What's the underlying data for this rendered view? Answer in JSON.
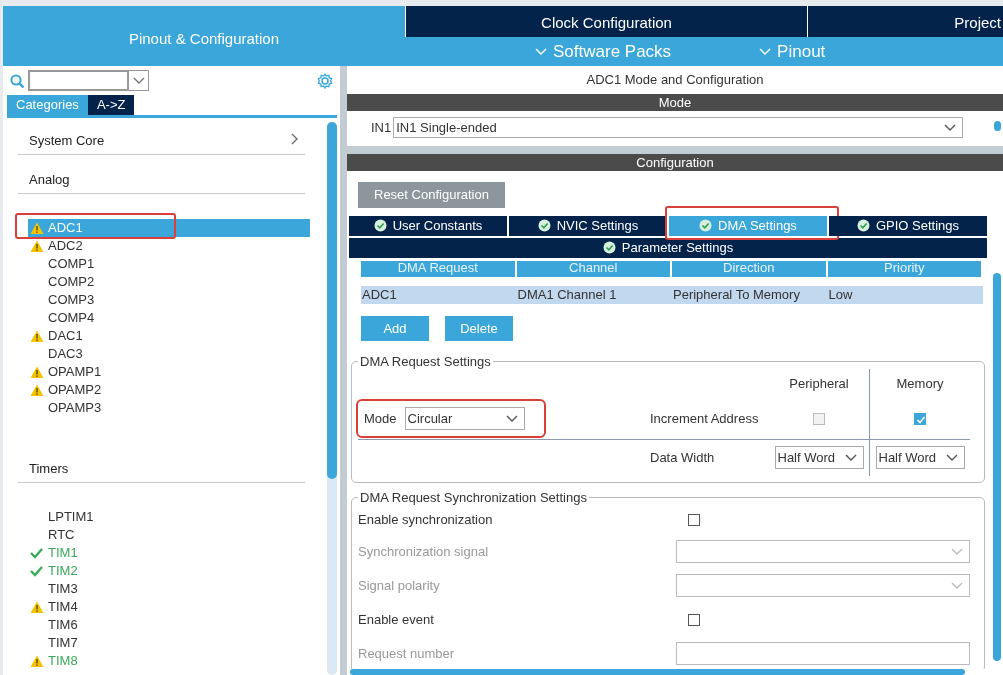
{
  "top_tabs": [
    {
      "label": "Pinout & Configuration",
      "selected": true
    },
    {
      "label": "Clock Configuration",
      "selected": false
    },
    {
      "label": "Project",
      "selected": false
    }
  ],
  "menus": [
    "Software Packs",
    "Pinout"
  ],
  "sidebar": {
    "view_tabs": [
      {
        "label": "Categories",
        "selected": true
      },
      {
        "label": "A->Z",
        "selected": false
      }
    ],
    "categories": [
      {
        "label": "System Core",
        "expanded": false
      },
      {
        "label": "Analog",
        "expanded": true,
        "children": [
          {
            "label": "ADC1",
            "kind": "warning",
            "configured": false,
            "selected": true,
            "highlighted": true
          },
          {
            "label": "ADC2",
            "kind": "warning",
            "configured": false,
            "selected": false,
            "highlighted": false
          },
          {
            "label": "COMP1",
            "kind": "plain",
            "configured": false,
            "selected": false,
            "highlighted": false
          },
          {
            "label": "COMP2",
            "kind": "plain",
            "configured": false,
            "selected": false,
            "highlighted": false
          },
          {
            "label": "COMP3",
            "kind": "plain",
            "configured": false,
            "selected": false,
            "highlighted": false
          },
          {
            "label": "COMP4",
            "kind": "plain",
            "configured": false,
            "selected": false,
            "highlighted": false
          },
          {
            "label": "DAC1",
            "kind": "warning",
            "configured": false,
            "selected": false,
            "highlighted": false
          },
          {
            "label": "DAC3",
            "kind": "plain",
            "configured": false,
            "selected": false,
            "highlighted": false
          },
          {
            "label": "OPAMP1",
            "kind": "warning",
            "configured": false,
            "selected": false,
            "highlighted": false
          },
          {
            "label": "OPAMP2",
            "kind": "warning",
            "configured": false,
            "selected": false,
            "highlighted": false
          },
          {
            "label": "OPAMP3",
            "kind": "plain",
            "configured": false,
            "selected": false,
            "highlighted": false
          }
        ]
      },
      {
        "label": "Timers",
        "expanded": true,
        "children": [
          {
            "label": "LPTIM1",
            "kind": "plain",
            "configured": false,
            "selected": false,
            "highlighted": false
          },
          {
            "label": "RTC",
            "kind": "plain",
            "configured": false,
            "selected": false,
            "highlighted": false
          },
          {
            "label": "TIM1",
            "kind": "ok",
            "configured": true,
            "selected": false,
            "highlighted": false
          },
          {
            "label": "TIM2",
            "kind": "ok",
            "configured": true,
            "selected": false,
            "highlighted": false
          },
          {
            "label": "TIM3",
            "kind": "plain",
            "configured": false,
            "selected": false,
            "highlighted": false
          },
          {
            "label": "TIM4",
            "kind": "warning",
            "configured": false,
            "selected": false,
            "highlighted": false
          },
          {
            "label": "TIM6",
            "kind": "plain",
            "configured": false,
            "selected": false,
            "highlighted": false
          },
          {
            "label": "TIM7",
            "kind": "plain",
            "configured": false,
            "selected": false,
            "highlighted": false
          },
          {
            "label": "TIM8",
            "kind": "warning",
            "configured": true,
            "selected": false,
            "highlighted": false
          }
        ]
      }
    ]
  },
  "panel": {
    "title": "ADC1 Mode and Configuration",
    "mode_section": {
      "title": "Mode",
      "fields": [
        {
          "label": "IN1",
          "value": "IN1 Single-ended"
        }
      ]
    },
    "config_section": {
      "title": "Configuration",
      "reset_button": "Reset Configuration",
      "tabs": [
        {
          "label": "User Constants",
          "selected": false,
          "highlighted": false
        },
        {
          "label": "NVIC Settings",
          "selected": false,
          "highlighted": false
        },
        {
          "label": "DMA Settings",
          "selected": true,
          "highlighted": true
        },
        {
          "label": "GPIO Settings",
          "selected": false,
          "highlighted": false
        },
        {
          "label": "Parameter Settings",
          "selected": false,
          "highlighted": false
        }
      ],
      "table": {
        "columns": [
          "DMA Request",
          "Channel",
          "Direction",
          "Priority"
        ],
        "rows": [
          {
            "cells": [
              "ADC1",
              "DMA1 Channel 1",
              "Peripheral To Memory",
              "Low"
            ],
            "selected": true
          }
        ]
      },
      "buttons": [
        "Add",
        "Delete"
      ],
      "request_settings": {
        "title": "DMA Request Settings",
        "mode": {
          "label": "Mode",
          "value": "Circular",
          "highlighted": true
        },
        "column_headers": [
          "Peripheral",
          "Memory"
        ],
        "increment": {
          "label": "Increment Address",
          "peripheral": {
            "checked": false,
            "disabled": true
          },
          "memory": {
            "checked": true
          }
        },
        "data_width": {
          "label": "Data Width",
          "peripheral": "Half Word",
          "memory": "Half Word"
        }
      },
      "sync_settings": {
        "title": "DMA Request Synchronization Settings",
        "rows": [
          {
            "kind": "checkbox",
            "label": "Enable synchronization",
            "checked": false,
            "disabled": false
          },
          {
            "kind": "select",
            "label": "Synchronization signal",
            "disabled": true
          },
          {
            "kind": "select",
            "label": "Signal polarity",
            "disabled": true
          },
          {
            "kind": "checkbox",
            "label": "Enable event",
            "checked": false,
            "disabled": false
          },
          {
            "kind": "input",
            "label": "Request number",
            "disabled": true
          }
        ]
      }
    }
  }
}
